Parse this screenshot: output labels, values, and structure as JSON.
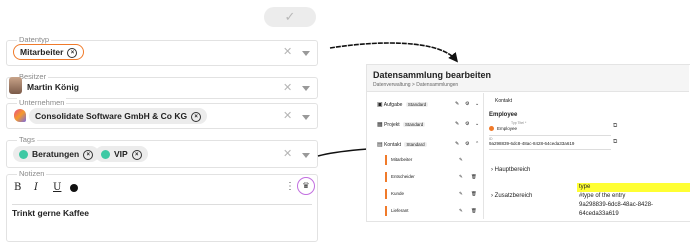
{
  "top_check": {
    "icon": "checkmark-icon"
  },
  "datentyp": {
    "legend": "Datentyp",
    "chip": "Mitarbeiter"
  },
  "besitzer": {
    "legend": "Besitzer",
    "value": "Martin König"
  },
  "unternehmen": {
    "legend": "Unternehmen",
    "chip": "Consolidate Software GmbH & Co KG"
  },
  "tags": {
    "legend": "Tags",
    "chips": [
      "Beratungen",
      "VIP"
    ]
  },
  "notizen": {
    "legend": "Notizen",
    "text": "Trinkt gerne Kaffee",
    "toolbar": [
      "B",
      "I",
      "U"
    ]
  },
  "panel": {
    "title": "Datensammlung bearbeiten",
    "breadcrumb": [
      "Datenverwaltung",
      ">",
      "Datensammlungen"
    ],
    "rows": [
      {
        "label": "Aufgabe",
        "badge": "Standard"
      },
      {
        "label": "Projekt",
        "badge": "Standard"
      },
      {
        "label": "Kontakt",
        "badge": "Standard"
      }
    ],
    "subitems": [
      "Mitarbeiter",
      "Entscheider",
      "Kunde",
      "Lieferant"
    ],
    "right_header": "Kontakt",
    "entity_name": "Employee",
    "field_label_small": "Typ Titel *",
    "field_value": "Employee",
    "id_label": "ID",
    "id_value": "9a298839-6dc8-48ac-8428-64ceda33a619",
    "sections": [
      "Hauptbereich",
      "Zusatzbereich"
    ]
  },
  "annotation": {
    "line1": "type",
    "line2": "#type of the entry",
    "line3": "9a298839-6dc8-48ac-8428-64ceda33a619",
    "highlight_color": "#ffff33"
  },
  "colors": {
    "accent": "#f07a2a",
    "tag_green": "#3ec9a4"
  }
}
